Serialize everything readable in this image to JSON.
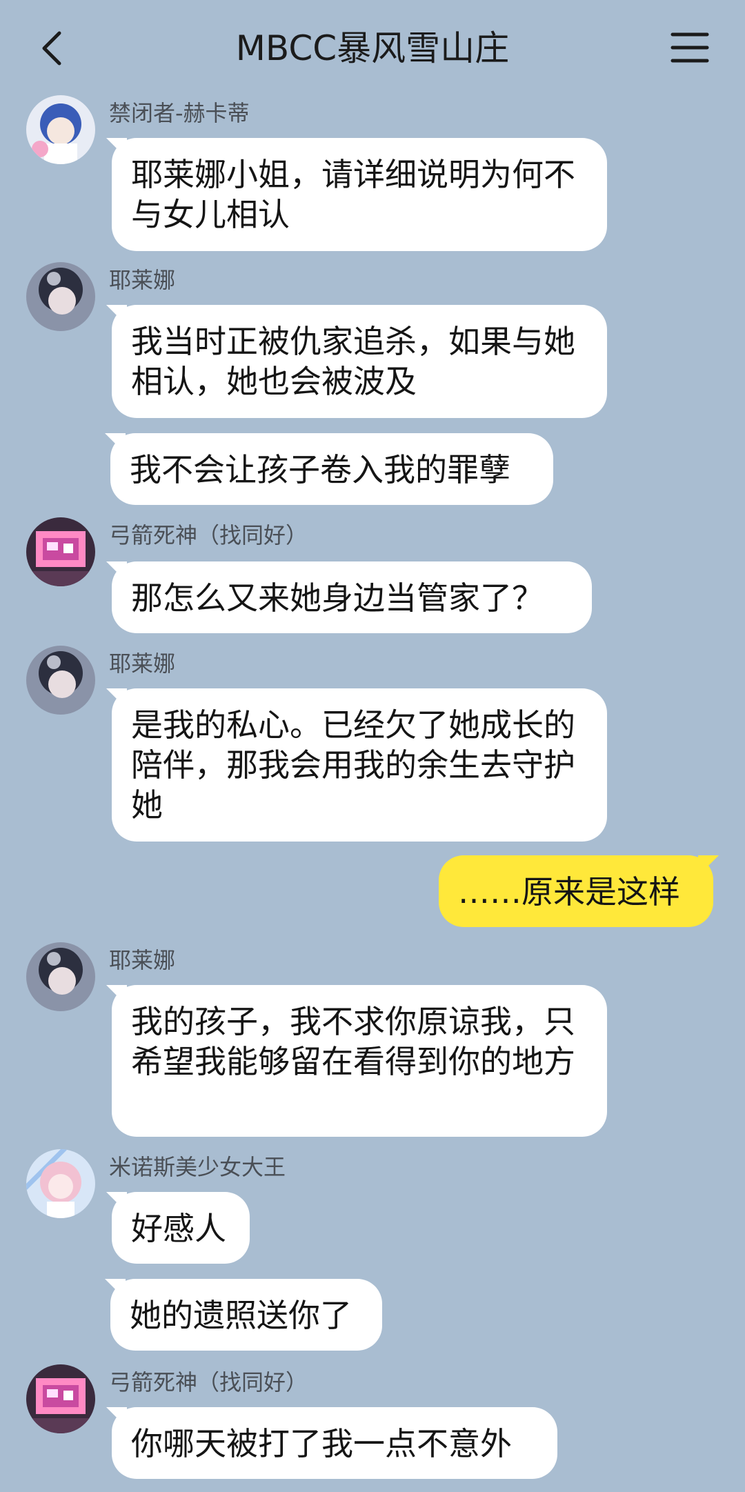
{
  "header": {
    "back_icon": "chevron-left-icon",
    "title": "MBCC暴风雪山庄",
    "menu_icon": "hamburger-menu-icon"
  },
  "messages": [
    {
      "sender": "禁闭者-赫卡蒂",
      "avatar": "avatar-hekadi",
      "bubbles": [
        "耶莱娜小姐，请详细说明为何不与女儿相认"
      ]
    },
    {
      "sender": "耶莱娜",
      "avatar": "avatar-yelaina",
      "bubbles": [
        "我当时正被仇家追杀，如果与她相认，她也会被波及",
        "我不会让孩子卷入我的罪孽"
      ]
    },
    {
      "sender": "弓箭死神（找同好）",
      "avatar": "avatar-archer",
      "bubbles": [
        "那怎么又来她身边当管家了？"
      ]
    },
    {
      "sender": "耶莱娜",
      "avatar": "avatar-yelaina",
      "bubbles": [
        "是我的私心。已经欠了她成长的陪伴，那我会用我的余生去守护她"
      ]
    },
    {
      "self": true,
      "bubbles": [
        "……原来是这样"
      ]
    },
    {
      "sender": "耶莱娜",
      "avatar": "avatar-yelaina",
      "bubbles": [
        "我的孩子，我不求你原谅我，只希望我能够留在看得到你的地方"
      ]
    },
    {
      "sender": "米诺斯美少女大王",
      "avatar": "avatar-minos",
      "bubbles": [
        "好感人",
        "她的遗照送你了"
      ]
    },
    {
      "sender": "弓箭死神（找同好）",
      "avatar": "avatar-archer",
      "bubbles": [
        "你哪天被打了我一点不意外"
      ]
    }
  ],
  "colors": {
    "background": "#a9bdd1",
    "bubble_other": "#ffffff",
    "bubble_self": "#ffe83a"
  }
}
